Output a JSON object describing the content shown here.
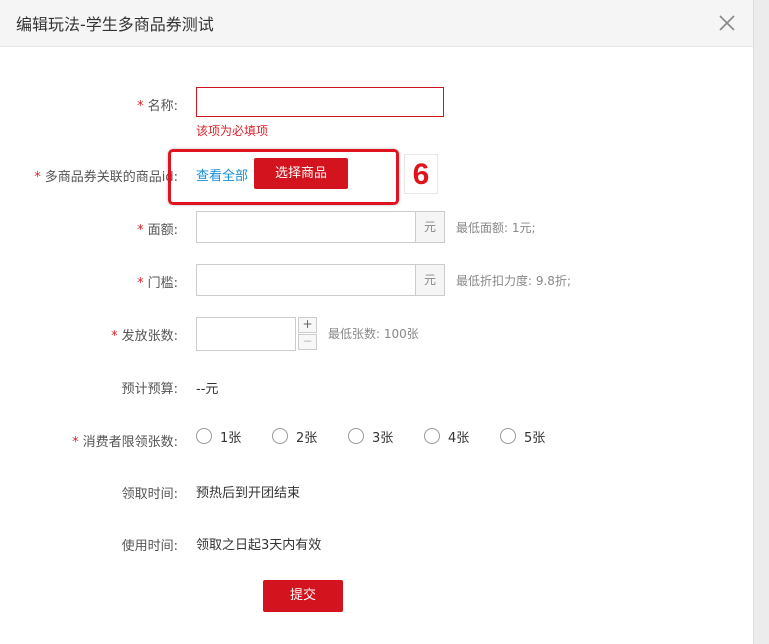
{
  "dialog": {
    "title": "编辑玩法-学生多商品券测试",
    "close_icon": "close-icon"
  },
  "form": {
    "name": {
      "required": "*",
      "label": "名称:",
      "value": "",
      "error": "该项为必填项"
    },
    "product_ids": {
      "required": "*",
      "label": "多商品券关联的商品id:",
      "view_all": "查看全部",
      "select_button": "选择商品",
      "step_badge": "6"
    },
    "face_value": {
      "required": "*",
      "label": "面额:",
      "value": "",
      "unit": "元",
      "hint": "最低面额: 1元;"
    },
    "threshold": {
      "required": "*",
      "label": "门槛:",
      "value": "",
      "unit": "元",
      "hint": "最低折扣力度: 9.8折;"
    },
    "quantity": {
      "required": "*",
      "label": "发放张数:",
      "value": "",
      "plus": "+",
      "minus": "−",
      "hint": "最低张数: 100张"
    },
    "budget": {
      "label": "预计预算:",
      "value": "--元"
    },
    "limit": {
      "required": "*",
      "label": "消费者限领张数:",
      "options": [
        "1张",
        "2张",
        "3张",
        "4张",
        "5张"
      ],
      "selected": null
    },
    "claim_time": {
      "label": "领取时间:",
      "value": "预热后到开团结束"
    },
    "use_time": {
      "label": "使用时间:",
      "value": "领取之日起3天内有效"
    },
    "submit": "提交"
  },
  "colors": {
    "accent": "#d3131e",
    "link": "#1a8ed8",
    "error": "#d9242b"
  }
}
